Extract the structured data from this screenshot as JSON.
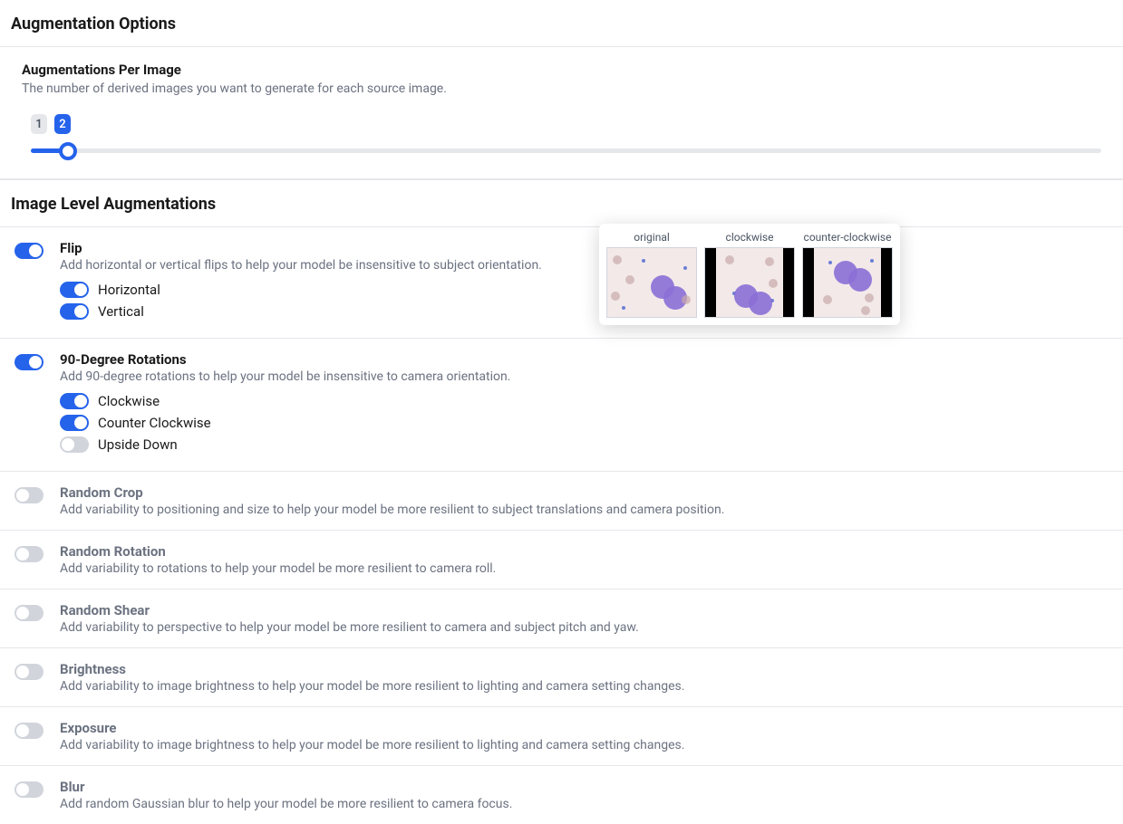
{
  "augOptions": {
    "header": "Augmentation Options",
    "perImage": {
      "title": "Augmentations Per Image",
      "desc": "The number of derived images you want to generate for each source image.",
      "chips": [
        "1",
        "2"
      ],
      "selected": "2",
      "sliderFillPercent": 3.5
    }
  },
  "imageLevel": {
    "header": "Image Level Augmentations",
    "items": [
      {
        "id": "flip",
        "enabled": true,
        "title": "Flip",
        "desc": "Add horizontal or vertical flips to help your model be insensitive to subject orientation.",
        "subopts": [
          {
            "label": "Horizontal",
            "on": true
          },
          {
            "label": "Vertical",
            "on": true
          }
        ]
      },
      {
        "id": "rot90",
        "enabled": true,
        "title": "90-Degree Rotations",
        "desc": "Add 90-degree rotations to help your model be insensitive to camera orientation.",
        "subopts": [
          {
            "label": "Clockwise",
            "on": true
          },
          {
            "label": "Counter Clockwise",
            "on": true
          },
          {
            "label": "Upside Down",
            "on": false
          }
        ]
      },
      {
        "id": "crop",
        "enabled": false,
        "title": "Random Crop",
        "desc": "Add variability to positioning and size to help your model be more resilient to subject translations and camera position."
      },
      {
        "id": "rrot",
        "enabled": false,
        "title": "Random Rotation",
        "desc": "Add variability to rotations to help your model be more resilient to camera roll."
      },
      {
        "id": "shear",
        "enabled": false,
        "title": "Random Shear",
        "desc": "Add variability to perspective to help your model be more resilient to camera and subject pitch and yaw."
      },
      {
        "id": "bright",
        "enabled": false,
        "title": "Brightness",
        "desc": "Add variability to image brightness to help your model be more resilient to lighting and camera setting changes."
      },
      {
        "id": "expo",
        "enabled": false,
        "title": "Exposure",
        "desc": "Add variability to image brightness to help your model be more resilient to lighting and camera setting changes."
      },
      {
        "id": "blur",
        "enabled": false,
        "title": "Blur",
        "desc": "Add random Gaussian blur to help your model be more resilient to camera focus."
      }
    ]
  },
  "preview": {
    "labels": [
      "original",
      "clockwise",
      "counter-clockwise"
    ]
  }
}
